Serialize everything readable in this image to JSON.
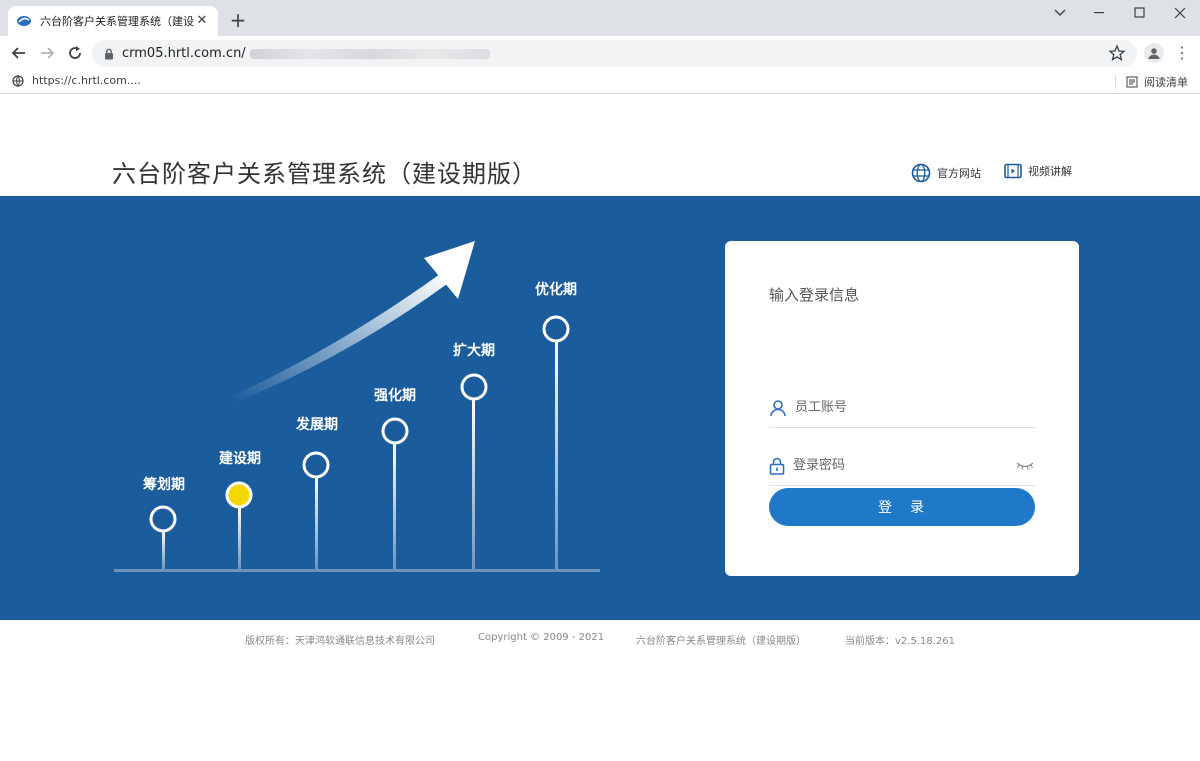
{
  "browser": {
    "tab_title": "六台阶客户关系管理系统（建设期",
    "tab_close": "✕",
    "new_tab": "+",
    "url_host": "crm05.hrtl.com.cn/",
    "bookmark": "https://c.hrtl.com....",
    "reading_list": "阅读清单"
  },
  "header": {
    "title": "六台阶客户关系管理系统（建设期版）",
    "official_site": "官方网站",
    "video_guide": "视频讲解"
  },
  "stages": [
    "筹划期",
    "建设期",
    "发展期",
    "强化期",
    "扩大期",
    "优化期"
  ],
  "current_stage": "建设期",
  "colors": {
    "hero_bg": "#1a5c9c",
    "active_stage": "#f5d800",
    "button": "#2078c8"
  },
  "login": {
    "heading": "输入登录信息",
    "account_placeholder": "员工账号",
    "password_placeholder": "登录密码",
    "submit": "登　录"
  },
  "footer": {
    "copyright_owner": "版权所有：天津鸿软通联信息技术有限公司",
    "copyright": "Copyright © 2009 - 2021",
    "system": "六台阶客户关系管理系统（建设期版）",
    "version": "当前版本：v2.5.18.261"
  },
  "icons": [
    "app-favicon",
    "close-icon",
    "minimize-icon",
    "maximize-icon",
    "back-icon",
    "forward-icon",
    "reload-icon",
    "lock-icon",
    "star-icon",
    "profile-icon",
    "menu-icon",
    "globe-icon",
    "video-icon",
    "user-icon",
    "password-lock-icon",
    "eye-closed-icon",
    "reading-list-icon"
  ]
}
